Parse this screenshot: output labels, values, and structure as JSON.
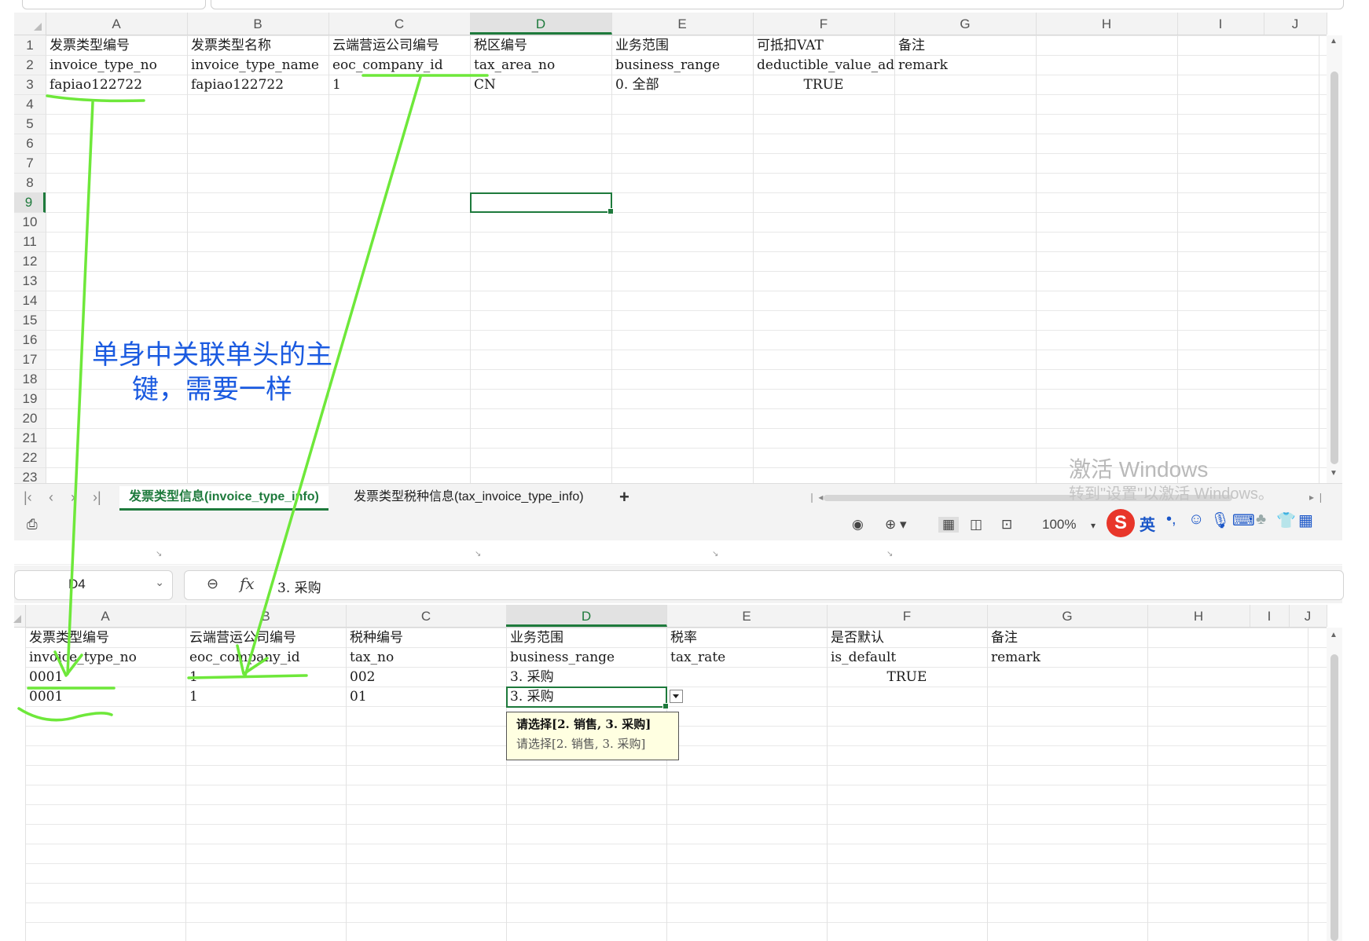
{
  "top_sheet": {
    "columns": [
      "A",
      "B",
      "C",
      "D",
      "E",
      "F",
      "G",
      "H",
      "I",
      "J"
    ],
    "selected_column": "D",
    "rows": [
      "1",
      "2",
      "3",
      "4",
      "5",
      "6",
      "7",
      "8",
      "9",
      "10",
      "11",
      "12",
      "13",
      "14",
      "15",
      "16",
      "17",
      "18",
      "19",
      "20",
      "21",
      "22",
      "23"
    ],
    "selected_row": "9",
    "cells": {
      "r1": [
        "发票类型编号",
        "发票类型名称",
        "云端营运公司编号",
        "税区编号",
        "业务范围",
        "可抵扣VAT",
        "备注"
      ],
      "r2": [
        "invoice_type_no",
        "invoice_type_name",
        "eoc_company_id",
        "tax_area_no",
        "business_range",
        "deductible_value_add",
        "remark"
      ],
      "r3": [
        "fapiao122722",
        "fapiao122722",
        "1",
        "CN",
        "0. 全部",
        "TRUE",
        ""
      ]
    },
    "tabs": [
      "发票类型信息(invoice_type_info)",
      "发票类型税种信息(tax_invoice_type_info)"
    ],
    "add_tab": "+",
    "zoom": "100%",
    "watermark_line1": "激活 Windows",
    "watermark_line2": "转到\"设置\"以激活 Windows。",
    "ime_label": "英"
  },
  "bottom_sheet": {
    "name_box": "D4",
    "formula_value": "3. 采购",
    "fx_label": "fx",
    "columns": [
      "A",
      "B",
      "C",
      "D",
      "E",
      "F",
      "G",
      "H",
      "I",
      "J"
    ],
    "selected_column": "D",
    "cells": {
      "r1": [
        "发票类型编号",
        "云端营运公司编号",
        "税种编号",
        "业务范围",
        "税率",
        "是否默认",
        "备注"
      ],
      "r2": [
        "invoice_type_no",
        "eoc_company_id",
        "tax_no",
        "business_range",
        "tax_rate",
        "is_default",
        "remark"
      ],
      "r3": [
        "0001",
        "1",
        "002",
        "3. 采购",
        "",
        "TRUE",
        ""
      ],
      "r4": [
        "0001",
        "1",
        "01",
        "3. 采购",
        "",
        "",
        ""
      ]
    },
    "validation_tooltip_title": "请选择[2. 销售, 3. 采购]",
    "validation_tooltip_text": "请选择[2. 销售, 3. 采购]"
  },
  "annotation": {
    "text_line1": "单身中关联单头的主",
    "text_line2": "键，需要一样",
    "color": "#1a5ae0",
    "arrow_color": "#6ee83a"
  }
}
